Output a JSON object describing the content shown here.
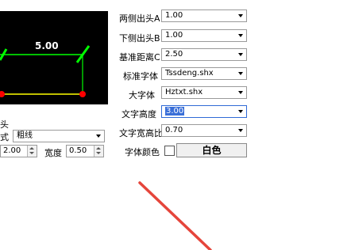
{
  "preview": {
    "dimension_text": "5.00",
    "line_color": "#00ff00",
    "dim_color": "#ffff00",
    "tick_color": "#00ff00",
    "dot_color": "#ff0000"
  },
  "left_panel": {
    "label_head": "头",
    "label_style": "式",
    "style_value": "粗线",
    "width_prefix_value": "2.00",
    "width_label": "宽度",
    "width_value": "0.50"
  },
  "fields": [
    {
      "label": "两侧出头A",
      "value": "1.00"
    },
    {
      "label": "下侧出头B",
      "value": "1.00"
    },
    {
      "label": "基准距离C",
      "value": "2.50"
    },
    {
      "label": "标准字体",
      "value": "Tssdeng.shx"
    },
    {
      "label": "大字体",
      "value": "Hztxt.shx"
    },
    {
      "label": "文字高度",
      "value": "3.00"
    },
    {
      "label": "文字宽高比",
      "value": "0.70"
    }
  ],
  "text_color": {
    "label": "字体颜色",
    "button_label": "白色"
  }
}
